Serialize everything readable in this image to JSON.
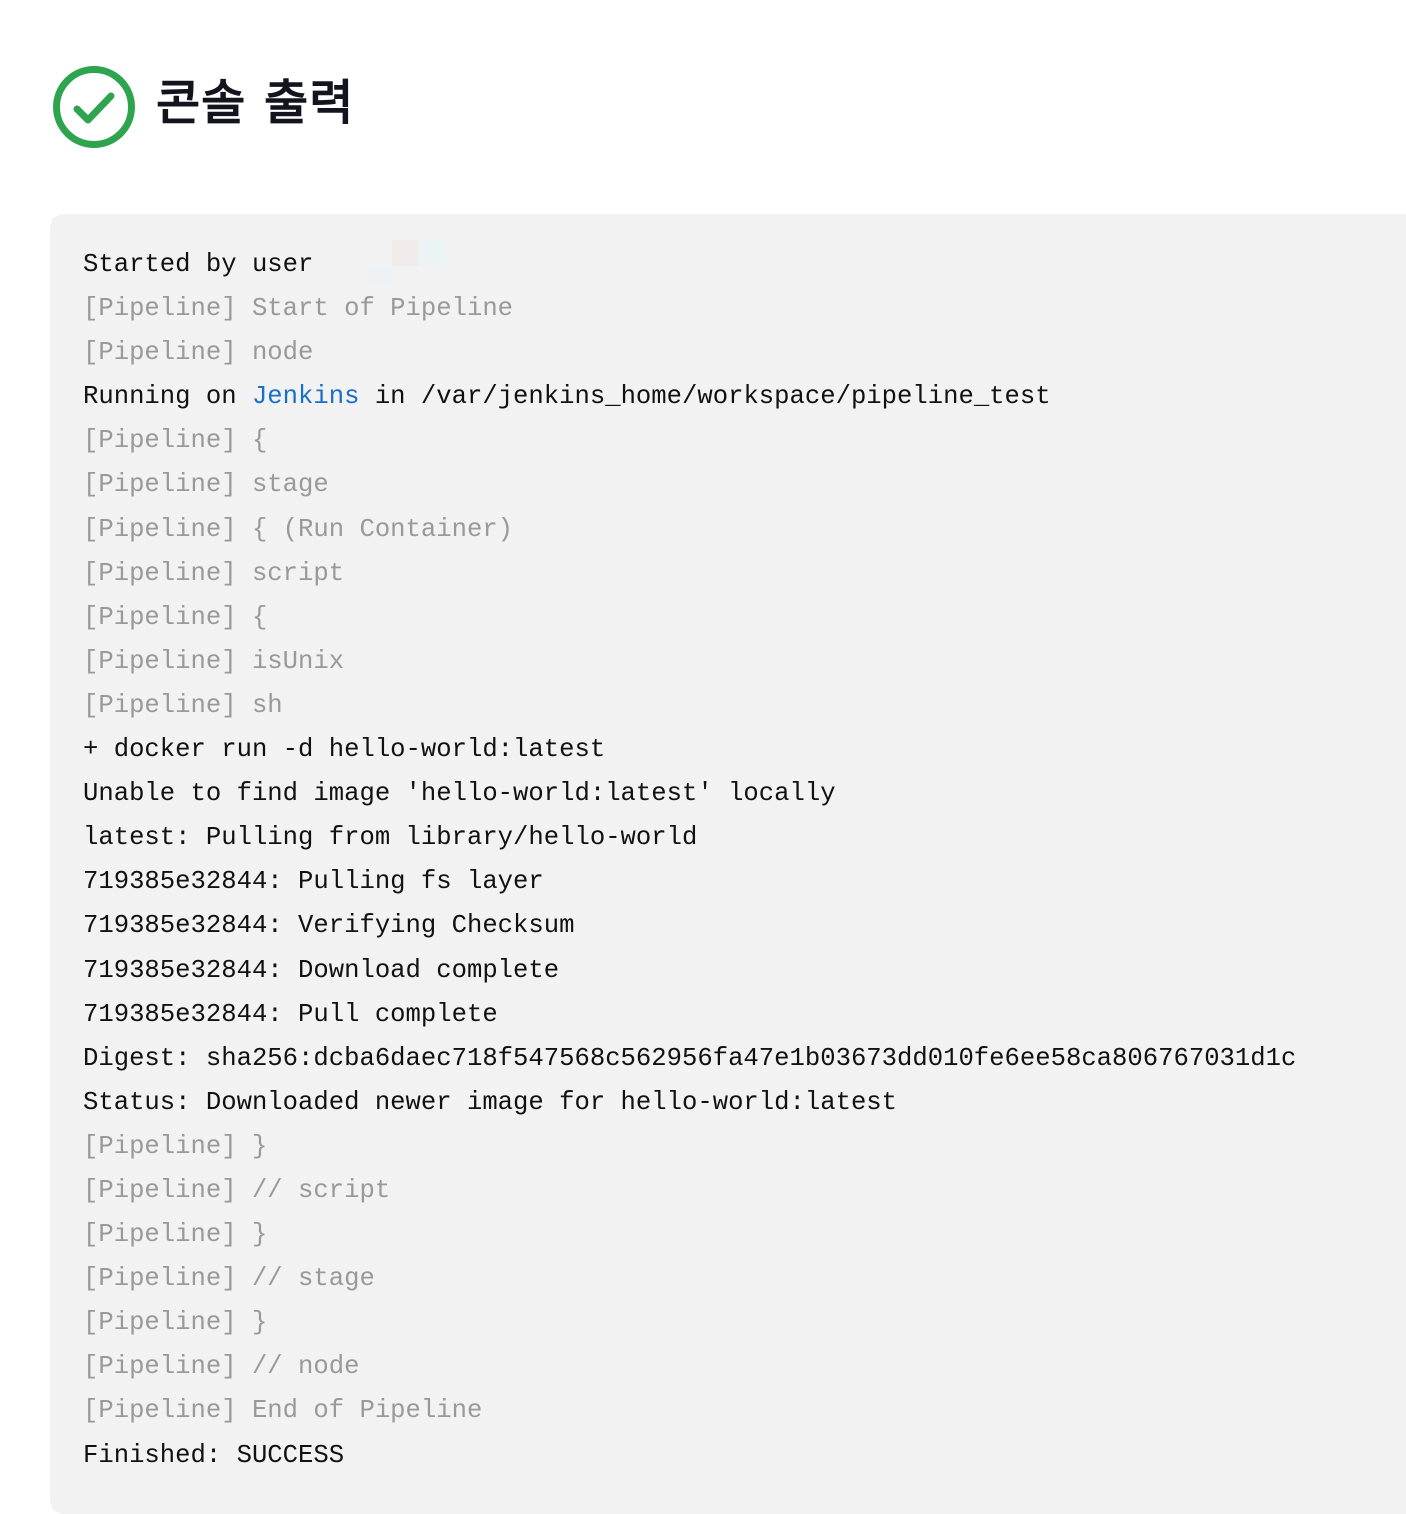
{
  "header": {
    "status": "success",
    "status_icon": "check-circle-icon",
    "status_color": "#2ea44f",
    "title": "콘솔 출력"
  },
  "console": {
    "lines": [
      {
        "type": "normal",
        "text": "Started by user"
      },
      {
        "type": "pipeline",
        "text": "[Pipeline] Start of Pipeline"
      },
      {
        "type": "pipeline",
        "text": "[Pipeline] node"
      },
      {
        "type": "link",
        "before": "Running on ",
        "link": "Jenkins",
        "after": " in /var/jenkins_home/workspace/pipeline_test"
      },
      {
        "type": "pipeline",
        "text": "[Pipeline] {"
      },
      {
        "type": "pipeline",
        "text": "[Pipeline] stage"
      },
      {
        "type": "pipeline",
        "text": "[Pipeline] { (Run Container)"
      },
      {
        "type": "pipeline",
        "text": "[Pipeline] script"
      },
      {
        "type": "pipeline",
        "text": "[Pipeline] {"
      },
      {
        "type": "pipeline",
        "text": "[Pipeline] isUnix"
      },
      {
        "type": "pipeline",
        "text": "[Pipeline] sh"
      },
      {
        "type": "normal",
        "text": "+ docker run -d hello-world:latest"
      },
      {
        "type": "normal",
        "text": "Unable to find image 'hello-world:latest' locally"
      },
      {
        "type": "normal",
        "text": "latest: Pulling from library/hello-world"
      },
      {
        "type": "normal",
        "text": "719385e32844: Pulling fs layer"
      },
      {
        "type": "normal",
        "text": "719385e32844: Verifying Checksum"
      },
      {
        "type": "normal",
        "text": "719385e32844: Download complete"
      },
      {
        "type": "normal",
        "text": "719385e32844: Pull complete"
      },
      {
        "type": "normal",
        "text": "Digest: sha256:dcba6daec718f547568c562956fa47e1b03673dd010fe6ee58ca806767031d1c"
      },
      {
        "type": "normal",
        "text": "Status: Downloaded newer image for hello-world:latest"
      },
      {
        "type": "pipeline",
        "text": "[Pipeline] }"
      },
      {
        "type": "pipeline",
        "text": "[Pipeline] // script"
      },
      {
        "type": "pipeline",
        "text": "[Pipeline] }"
      },
      {
        "type": "pipeline",
        "text": "[Pipeline] // stage"
      },
      {
        "type": "pipeline",
        "text": "[Pipeline] }"
      },
      {
        "type": "pipeline",
        "text": "[Pipeline] // node"
      },
      {
        "type": "pipeline",
        "text": "[Pipeline] End of Pipeline"
      },
      {
        "type": "normal",
        "text": "Finished: SUCCESS"
      }
    ]
  }
}
